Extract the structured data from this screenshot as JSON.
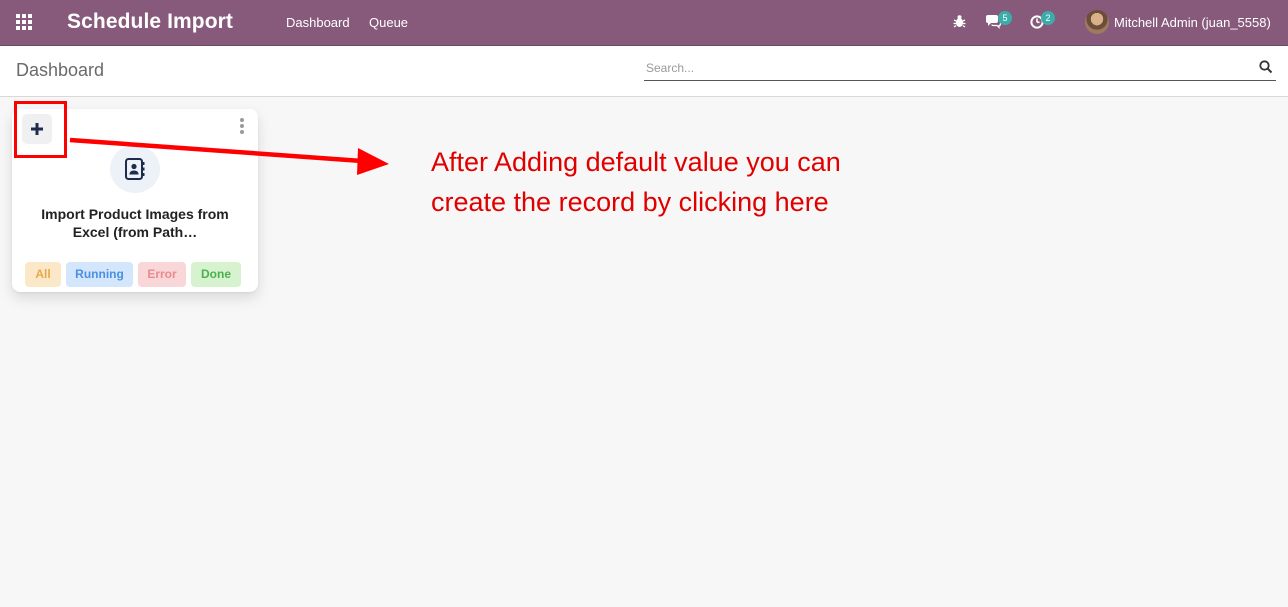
{
  "navbar": {
    "app_title": "Schedule Import",
    "menu": [
      "Dashboard",
      "Queue"
    ],
    "systray": {
      "debug_icon": "bug-icon",
      "messages_icon": "chat-icon",
      "messages_count": "5",
      "activities_icon": "clock-icon",
      "activities_count": "2",
      "user_name": "Mitchell Admin (juan_5558)"
    },
    "apps_icon": "grid-icon",
    "color": "#875a7b"
  },
  "control_panel": {
    "breadcrumb": "Dashboard",
    "search_placeholder": "Search..."
  },
  "cards": [
    {
      "title": "Import Product Images from Excel (from Path…",
      "icon": "address-book-icon",
      "statuses": [
        "All",
        "Running",
        "Error",
        "Done"
      ]
    }
  ],
  "annotation": {
    "text_line1": "After Adding default value you can",
    "text_line2": "create the record by clicking here",
    "color": "#ff0000"
  }
}
